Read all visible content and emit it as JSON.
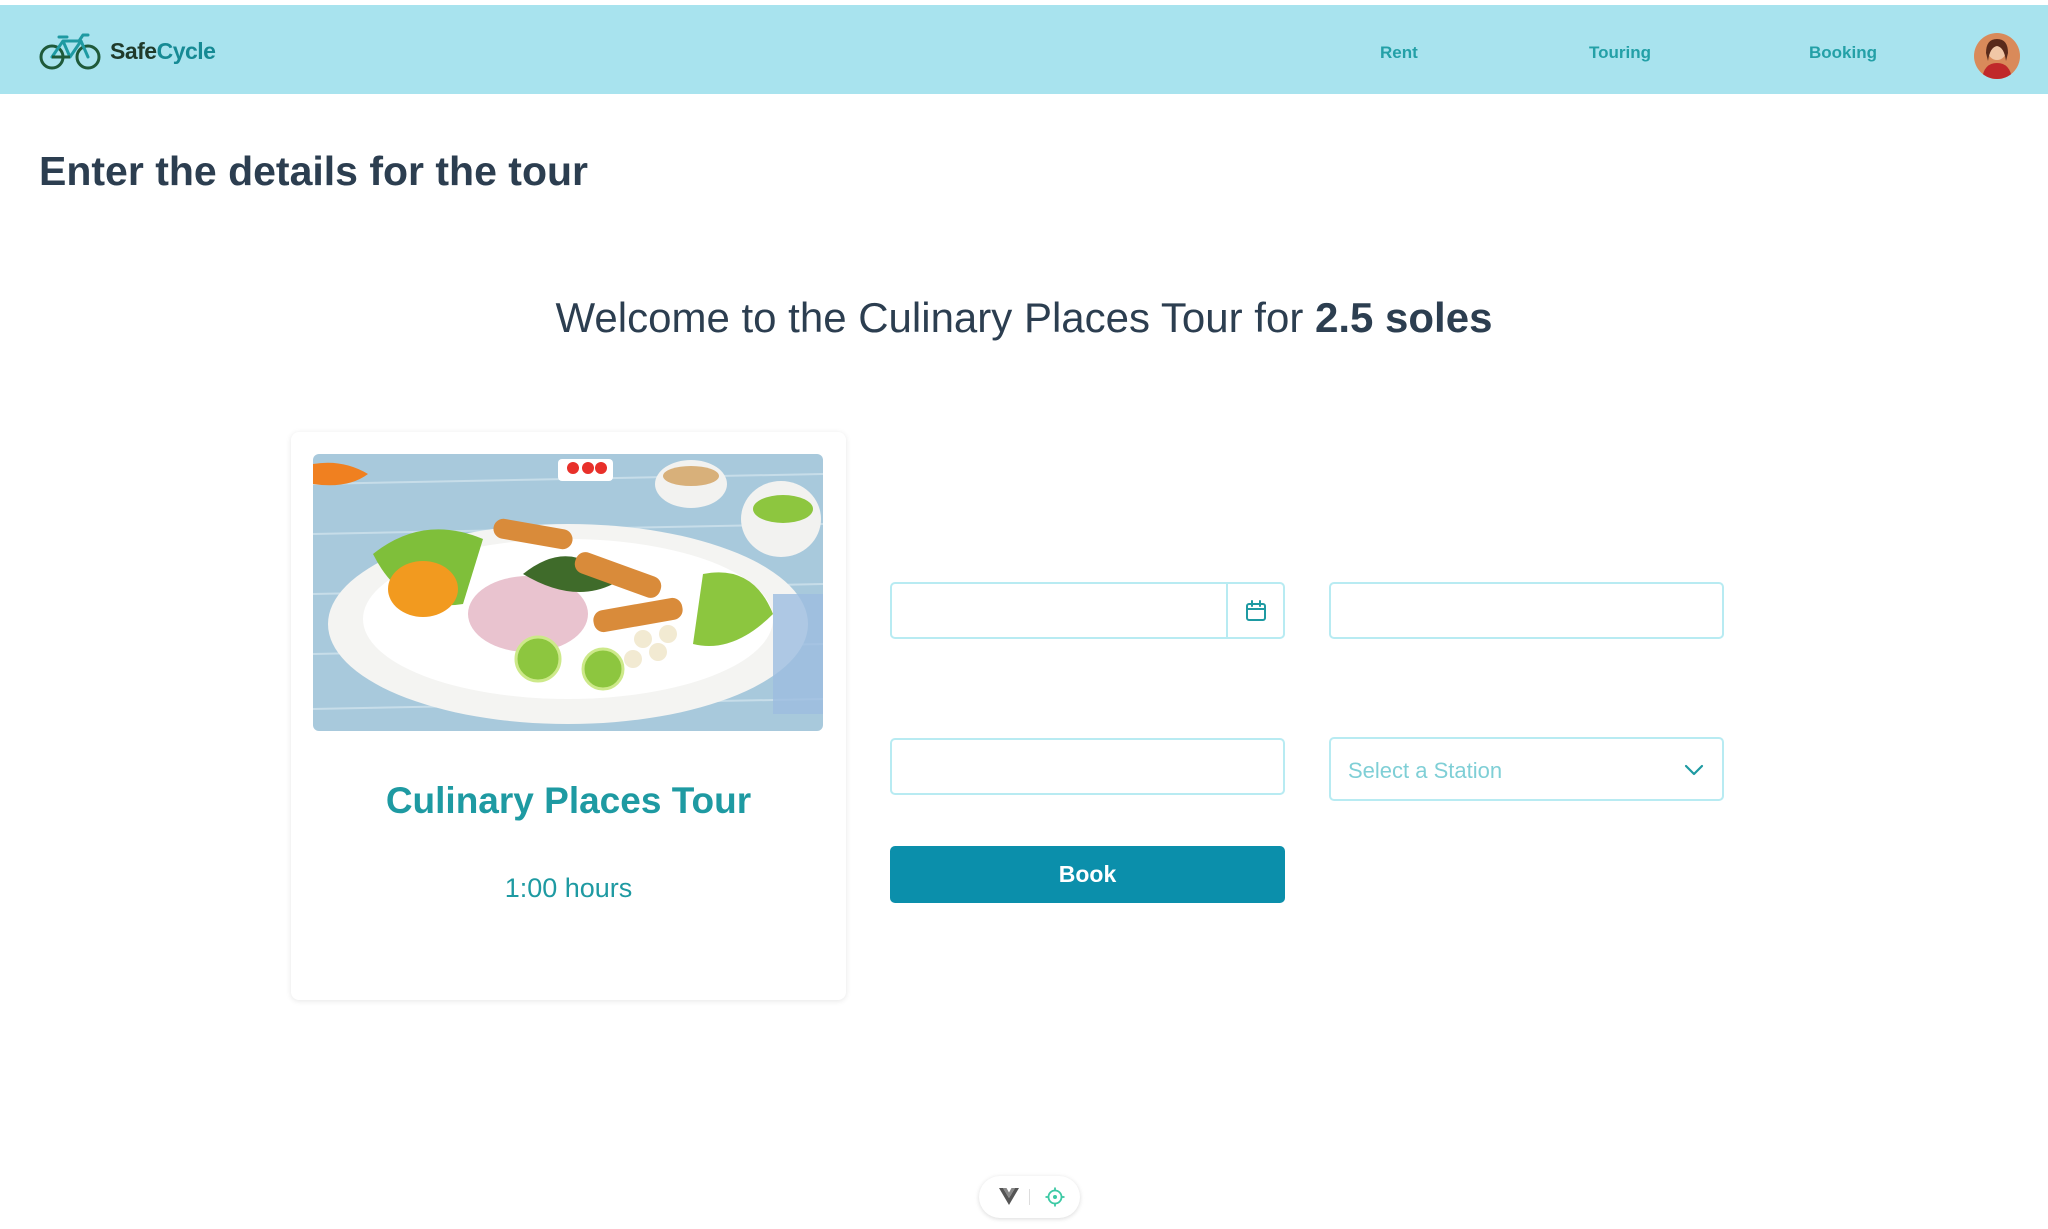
{
  "header": {
    "logo_text_part1": "Safe",
    "logo_text_part2": "Cycle",
    "nav": [
      {
        "label": "Rent"
      },
      {
        "label": "Touring"
      },
      {
        "label": "Booking"
      }
    ]
  },
  "page": {
    "title": "Enter the details for the tour",
    "welcome_prefix": "Welcome to the Culinary Places Tour for ",
    "welcome_price": "2.5 soles"
  },
  "tour_card": {
    "name": "Culinary Places Tour",
    "duration": "1:00 hours"
  },
  "form": {
    "date_value": "",
    "field2_value": "",
    "field3_value": "",
    "station_placeholder": "Select a Station",
    "book_label": "Book"
  },
  "colors": {
    "header_bg": "#a8e3ee",
    "accent": "#1e9aa2",
    "button": "#0b8fab",
    "input_border": "#b8ebf2",
    "text_dark": "#2c3e50"
  },
  "icons": [
    "bicycle-logo-icon",
    "calendar-icon",
    "chevron-down-icon",
    "vue-devtools-icon",
    "crosshair-icon"
  ]
}
